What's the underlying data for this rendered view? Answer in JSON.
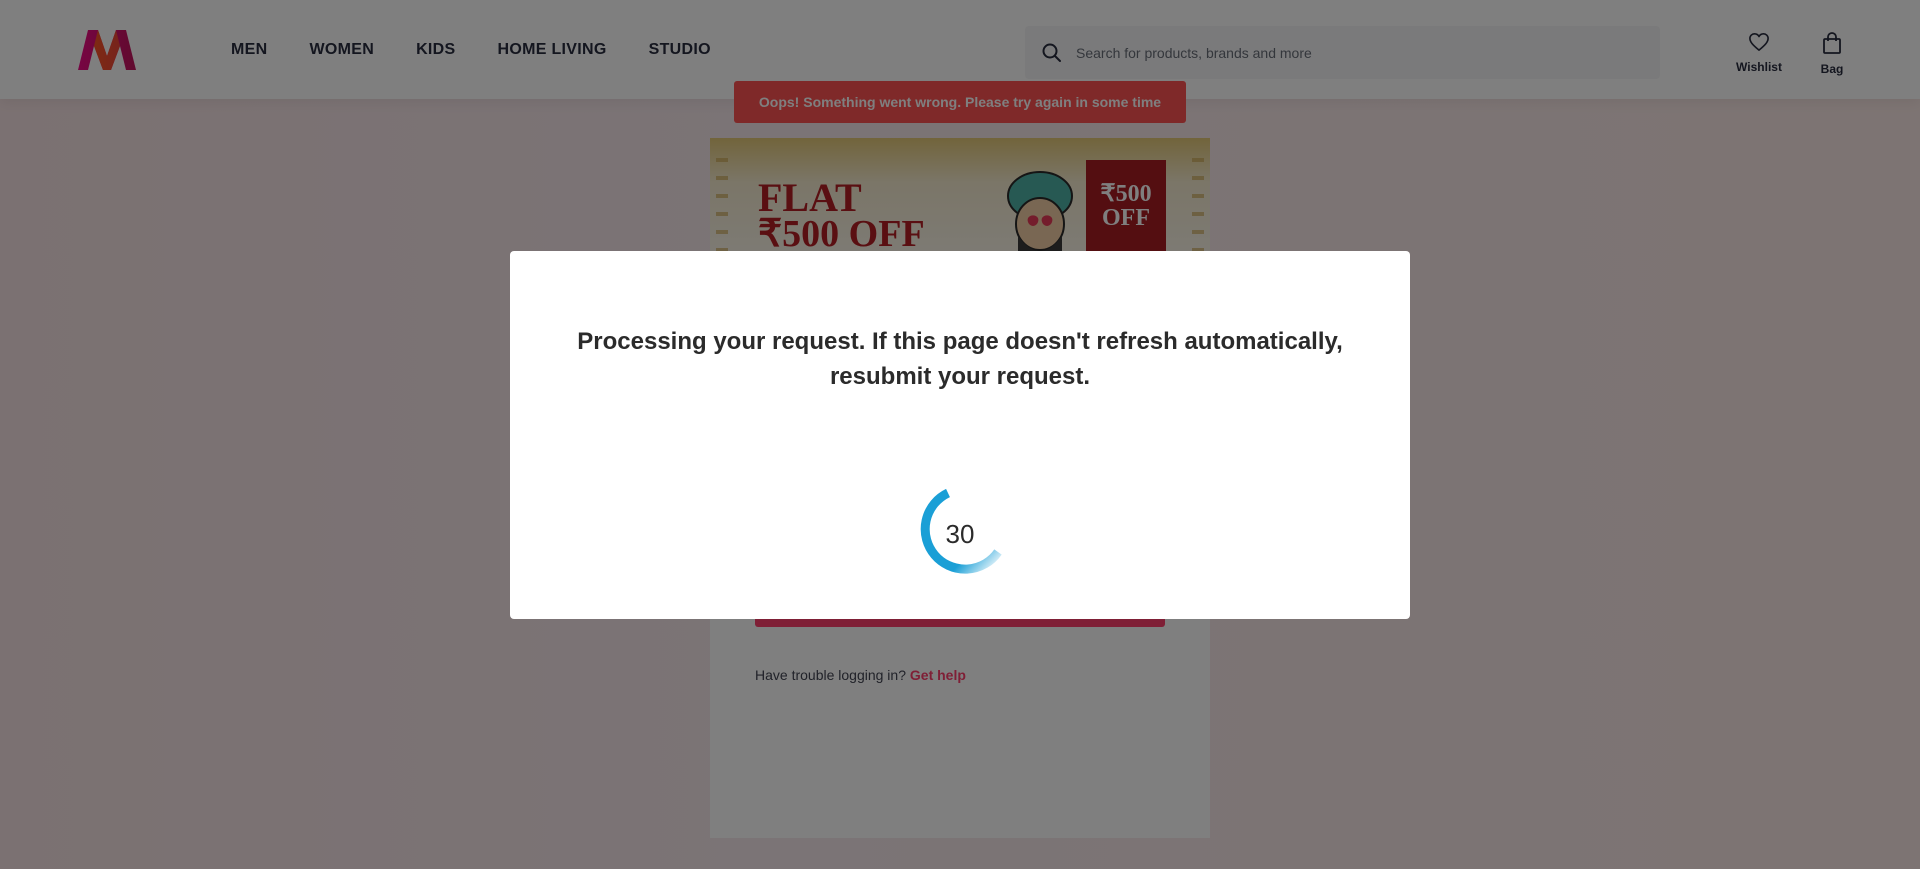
{
  "header": {
    "nav": [
      "MEN",
      "WOMEN",
      "KIDS",
      "HOME LIVING",
      "STUDIO"
    ],
    "search_placeholder": "Search for products, brands and more",
    "wishlist_label": "Wishlist",
    "bag_label": "Bag"
  },
  "toast": {
    "message": "Oops! Something went wrong. Please try again in some time"
  },
  "banner": {
    "line1": "FLAT",
    "line2": "₹500 OFF",
    "ribbon_line1": "₹500",
    "ribbon_line2": "OFF"
  },
  "login": {
    "trouble_text": "Have trouble logging in?",
    "get_help": "Get help"
  },
  "modal": {
    "message": "Processing your request. If this page doesn't refresh automatically, resubmit your request.",
    "countdown": "30"
  },
  "colors": {
    "accent": "#ff3f6c",
    "error": "#ff5252",
    "spinner": "#1a9fd6"
  },
  "icons": [
    "myntra-logo",
    "search-icon",
    "heart-icon",
    "bag-icon",
    "spinner-icon"
  ]
}
